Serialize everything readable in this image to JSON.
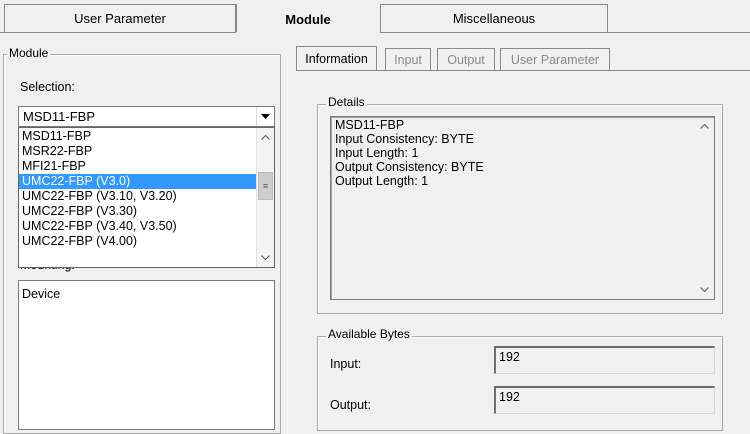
{
  "top_tabs": [
    {
      "label": "User Parameter"
    },
    {
      "label": "Module"
    },
    {
      "label": "Miscellaneous"
    }
  ],
  "module_group": {
    "title": "Module",
    "selection_label": "Selection:",
    "selection_value": "MSD11-FBP",
    "mounting_label": "Mounting:",
    "dropdown_items": [
      "MSD11-FBP",
      "MSR22-FBP",
      "MFI21-FBP",
      "UMC22-FBP (V3.0)",
      "UMC22-FBP (V3.10, V3.20)",
      "UMC22-FBP (V3.30)",
      "UMC22-FBP (V3.40, V3.50)",
      "UMC22-FBP (V4.00)"
    ],
    "selected_index": 3,
    "mounting_items": [
      "Device"
    ]
  },
  "inner_tabs": [
    {
      "label": "Information"
    },
    {
      "label": "Input"
    },
    {
      "label": "Output"
    },
    {
      "label": "User Parameter"
    }
  ],
  "details": {
    "title": "Details",
    "lines": [
      "MSD11-FBP",
      "Input Consistency: BYTE",
      "Input Length: 1",
      "Output Consistency: BYTE",
      "Output Length: 1"
    ]
  },
  "available_bytes": {
    "title": "Available Bytes",
    "input_label": "Input:",
    "input_value": "192",
    "output_label": "Output:",
    "output_value": "192"
  },
  "colors": {
    "selection_highlight": "#3399ff",
    "background": "#f0f0f0"
  }
}
